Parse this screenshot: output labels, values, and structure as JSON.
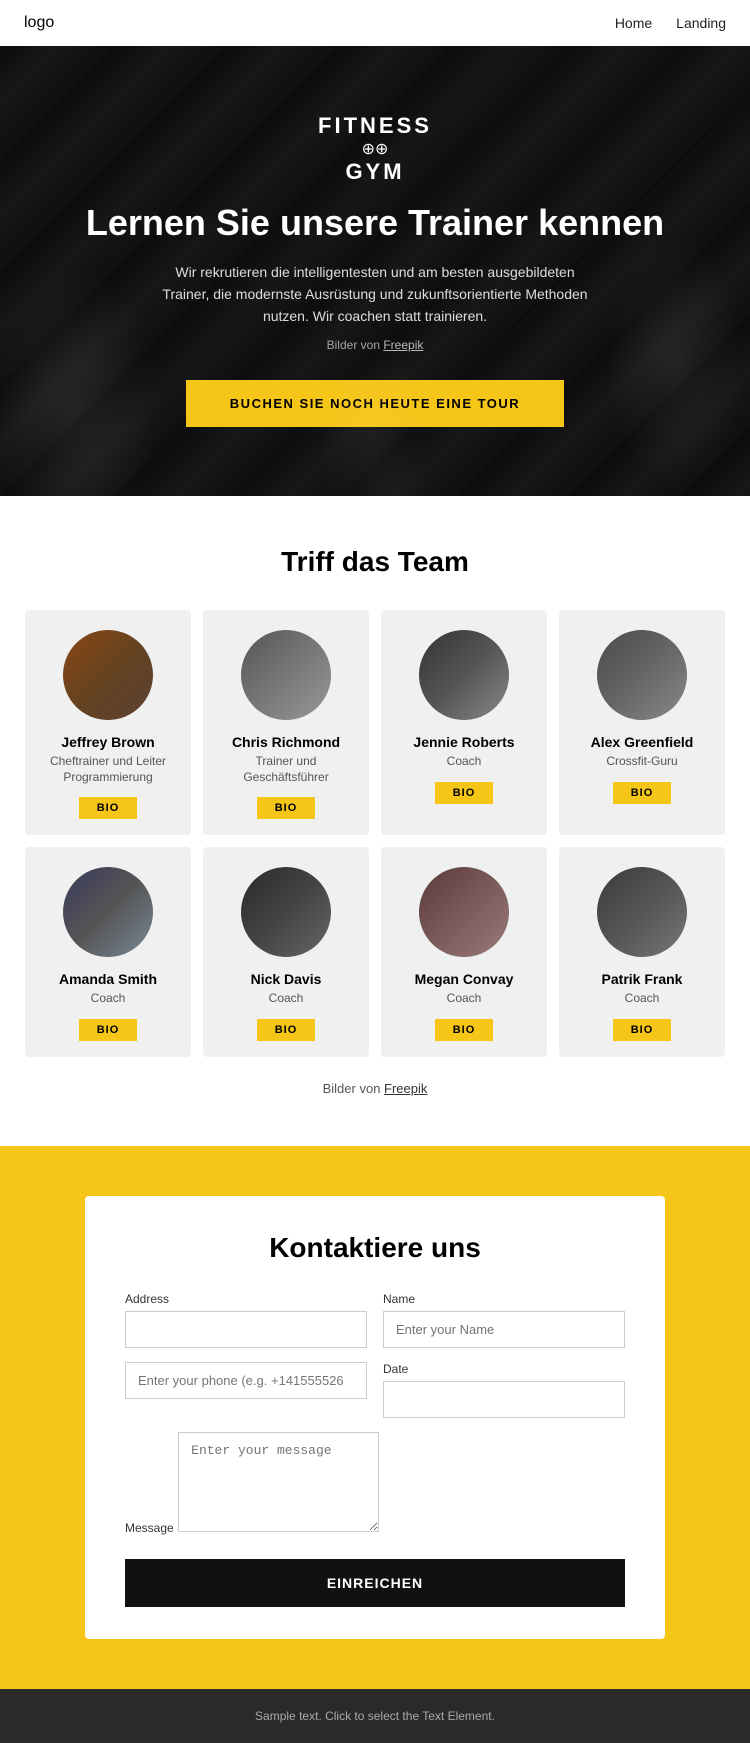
{
  "nav": {
    "logo": "logo",
    "links": [
      "Home",
      "Landing"
    ]
  },
  "hero": {
    "gym_logo_line1": "FITNESS",
    "gym_logo_line2": "GYM",
    "gym_logo_icon": "⊕",
    "title": "Lernen Sie unsere Trainer kennen",
    "subtitle": "Wir rekrutieren die intelligentesten und am besten ausgebildeten Trainer, die modernste Ausrüstung und zukunftsorientierte Methoden nutzen. Wir coachen statt trainieren.",
    "credit_prefix": "Bilder von ",
    "credit_link": "Freepik",
    "cta_button": "BUCHEN SIE NOCH HEUTE EINE TOUR"
  },
  "team": {
    "title": "Triff das Team",
    "members": [
      {
        "name": "Jeffrey Brown",
        "role": "Cheftrainer und Leiter Programmierung",
        "av": "av-jeffrey"
      },
      {
        "name": "Chris Richmond",
        "role": "Trainer und Geschäftsführer",
        "av": "av-chris"
      },
      {
        "name": "Jennie Roberts",
        "role": "Coach",
        "av": "av-jennie"
      },
      {
        "name": "Alex Greenfield",
        "role": "Crossfit-Guru",
        "av": "av-alex"
      },
      {
        "name": "Amanda Smith",
        "role": "Coach",
        "av": "av-amanda"
      },
      {
        "name": "Nick Davis",
        "role": "Coach",
        "av": "av-nick"
      },
      {
        "name": "Megan Convay",
        "role": "Coach",
        "av": "av-megan"
      },
      {
        "name": "Patrik Frank",
        "role": "Coach",
        "av": "av-patrik"
      }
    ],
    "bio_label": "BIO",
    "credit_prefix": "Bilder von ",
    "credit_link": "Freepik"
  },
  "contact": {
    "title": "Kontaktiere uns",
    "address_label": "Address",
    "name_label": "Name",
    "name_placeholder": "Enter your Name",
    "phone_placeholder": "Enter your phone (e.g. +141555526",
    "date_label": "Date",
    "message_label": "Message",
    "message_placeholder": "Enter your message",
    "submit_label": "EINREICHEN",
    "enter_your": "Enter your"
  },
  "footer": {
    "text": "Sample text. Click to select the Text Element."
  }
}
